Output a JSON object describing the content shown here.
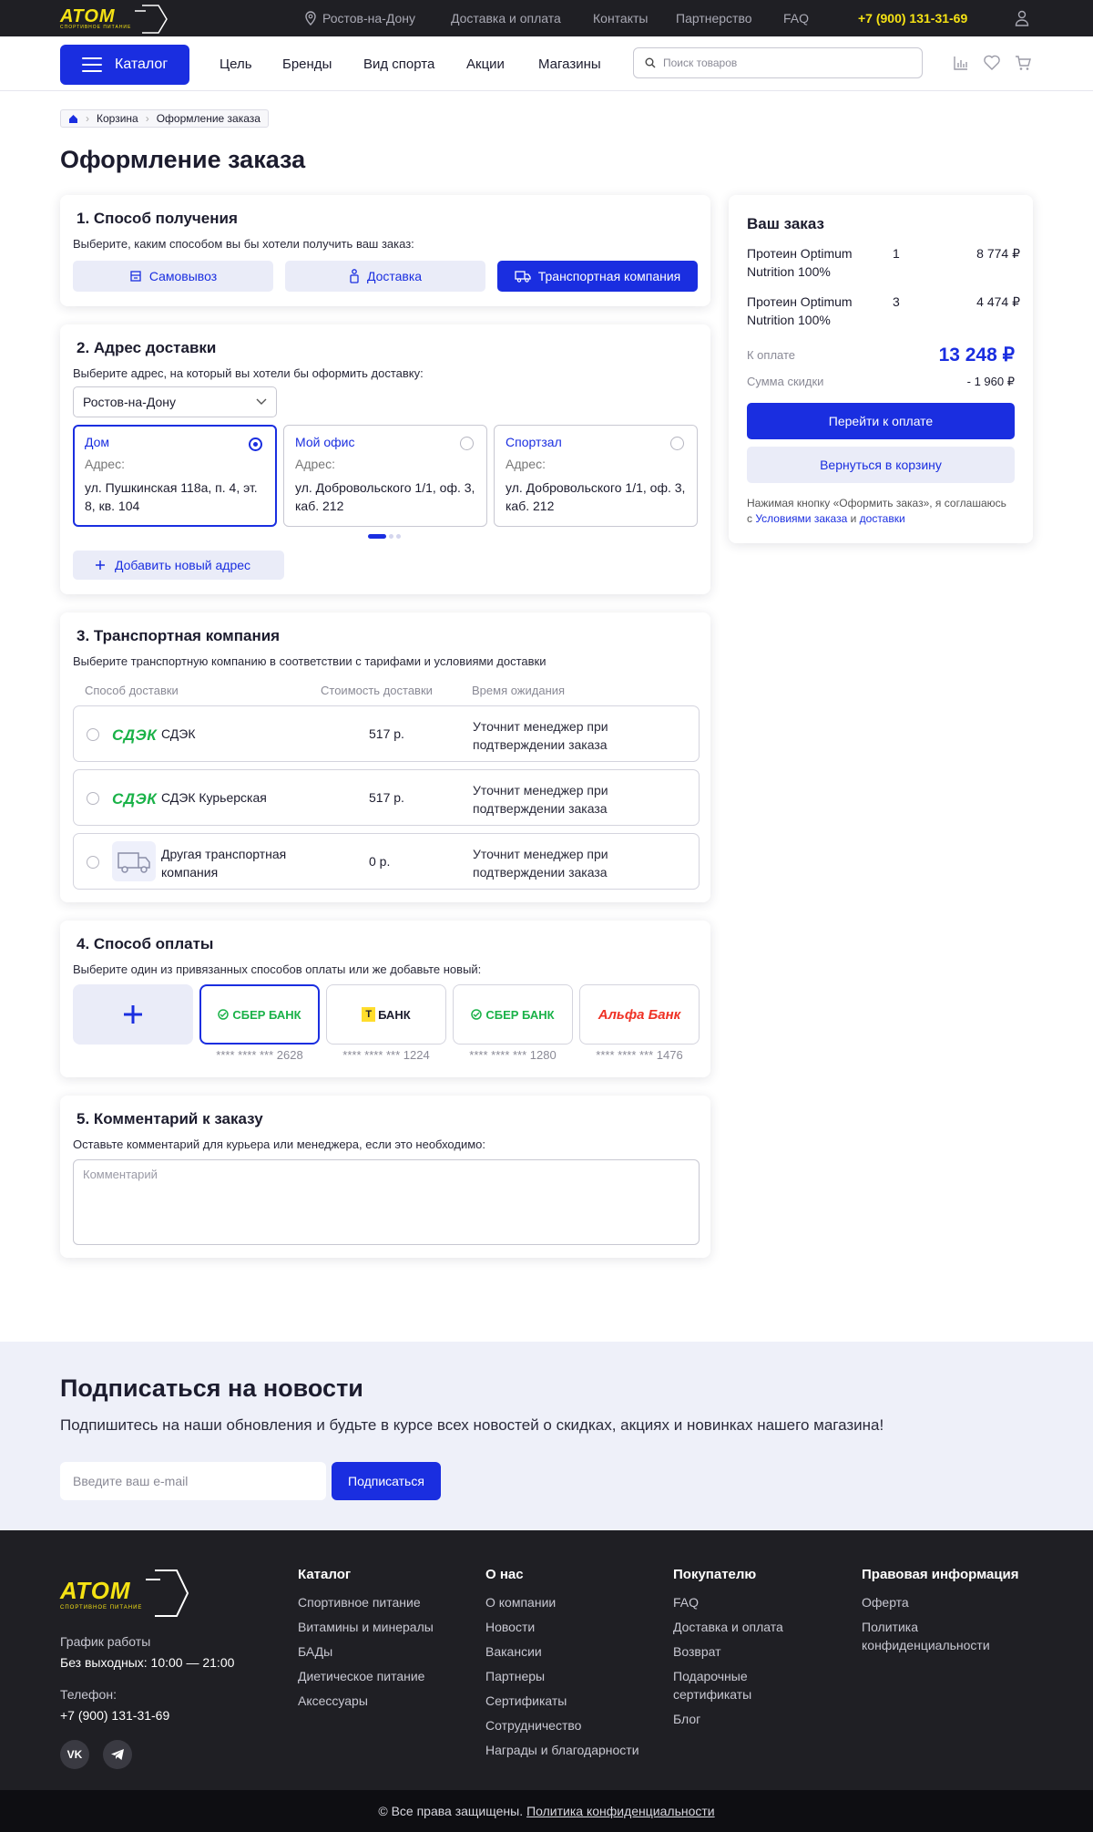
{
  "topbar": {
    "logo_text": "АТОМ",
    "logo_subtext": "СПОРТИВНОЕ ПИТАНИЕ",
    "city": "Ростов-на-Дону",
    "links": [
      "Доставка и оплата",
      "Контакты",
      "Партнерство",
      "FAQ"
    ],
    "phone": "+7 (900) 131-31-69"
  },
  "navbar": {
    "catalog_label": "Каталог",
    "links": [
      "Цель",
      "Бренды",
      "Вид спорта",
      "Акции",
      "Магазины"
    ],
    "search_placeholder": "Поиск товаров"
  },
  "breadcrumbs": [
    "Корзина",
    "Оформление заказа"
  ],
  "page_title": "Оформление заказа",
  "step1": {
    "title": "1. Способ получения",
    "subtitle": "Выберите, каким способом вы бы хотели получить ваш заказ:",
    "methods": [
      "Самовывоз",
      "Доставка",
      "Транспортная компания"
    ],
    "selected": "Транспортная компания"
  },
  "step2": {
    "title": "2. Адрес доставки",
    "subtitle": "Выберите адрес, на который вы хотели бы оформить доставку:",
    "city_select": "Ростов-на-Дону",
    "addresses": [
      {
        "name": "Дом",
        "label": "Адрес:",
        "value": "ул. Пушкинская 118а, п. 4, эт. 8, кв. 104"
      },
      {
        "name": "Мой офис",
        "label": "Адрес:",
        "value": "ул. Добровольского 1/1, оф. 3, каб. 212"
      },
      {
        "name": "Спортзал",
        "label": "Адрес:",
        "value": "ул. Добровольского 1/1, оф. 3, каб. 212"
      }
    ],
    "add_label": "Добавить новый адрес"
  },
  "step3": {
    "title": "3. Транспортная компания",
    "subtitle": "Выберите транспортную компанию в соответствии с тарифами и условиями доставки",
    "columns": [
      "Способ доставки",
      "Стоимость доставки",
      "Время ожидания"
    ],
    "logo_text": "СДЭК",
    "rows": [
      {
        "name": "СДЭК",
        "price": "517 р.",
        "wait": "Уточнит менеджер при подтверждении заказа"
      },
      {
        "name": "СДЭК Курьерская",
        "price": "517 р.",
        "wait": "Уточнит менеджер при подтверждении заказа"
      },
      {
        "name": "Другая транспортная компания",
        "price": "0 р.",
        "wait": "Уточнит менеджер при подтверждении заказа"
      }
    ]
  },
  "step4": {
    "title": "4. Способ оплаты",
    "subtitle": "Выберите один из привязанных способов оплаты или же добавьте новый:",
    "cards": [
      {
        "bank": "СБЕР БАНК",
        "number": "**** **** *** 2628",
        "color": "#1ab248"
      },
      {
        "bank": "БАНК",
        "number": "**** **** *** 1224",
        "color": "#1c1c2e"
      },
      {
        "bank": "СБЕР БАНК",
        "number": "**** **** *** 1280",
        "color": "#1ab248"
      },
      {
        "bank": "Альфа Банк",
        "number": "**** **** *** 1476",
        "color": "#ef3124"
      }
    ]
  },
  "step5": {
    "title": "5. Комментарий к заказу",
    "subtitle": "Оставьте комментарий для курьера или менеджера, если это необходимо:",
    "placeholder": "Комментарий"
  },
  "summary": {
    "title": "Ваш заказ",
    "items": [
      {
        "name": "Протеин Optimum Nutrition 100%",
        "qty": "1",
        "price": "8 774 ₽"
      },
      {
        "name": "Протеин Optimum Nutrition 100%",
        "qty": "3",
        "price": "4 474 ₽"
      }
    ],
    "total_label": "К оплате",
    "total": "13 248 ₽",
    "discount_label": "Сумма скидки",
    "discount": "- 1 960 ₽",
    "pay_button": "Перейти к оплате",
    "back_button": "Вернуться в корзину",
    "agree_text": "Нажимая кнопку «Оформить заказ», я соглашаюсь с",
    "agree_link1": "Условиями заказа",
    "agree_and": "и",
    "agree_link2": "доставки"
  },
  "subscribe": {
    "title": "Подписаться на новости",
    "text": "Подпишитесь на наши обновления и будьте в курсе всех новостей о скидках, акциях и новинках нашего магазина!",
    "placeholder": "Введите ваш e-mail",
    "button": "Подписаться"
  },
  "footer": {
    "schedule_label": "График работы",
    "schedule": "Без выходных: 10:00 — 21:00",
    "phone_label": "Телефон:",
    "phone": "+7 (900) 131-31-69",
    "columns": [
      {
        "title": "Каталог",
        "items": [
          "Спортивное питание",
          "Витамины и минералы",
          "БАДы",
          "Диетическое питание",
          "Аксессуары"
        ]
      },
      {
        "title": "О нас",
        "items": [
          "О компании",
          "Новости",
          "Вакансии",
          "Партнеры",
          "Сертификаты",
          "Сотрудничество",
          "Награды и благодарности"
        ]
      },
      {
        "title": "Покупателю",
        "items": [
          "FAQ",
          "Доставка и оплата",
          "Возврат",
          "Подарочные сертификаты",
          "Блог"
        ]
      },
      {
        "title": "Правовая информация",
        "items": [
          "Оферта",
          "Политика конфиденциальности"
        ]
      }
    ],
    "copyright": "© Все права защищены.",
    "privacy_link": "Политика конфиденциальности"
  },
  "colors": {
    "accent": "#1a2ee0",
    "brand_yellow": "#f5e214",
    "dark": "#1f1f24",
    "cdek_green": "#1ab248"
  }
}
